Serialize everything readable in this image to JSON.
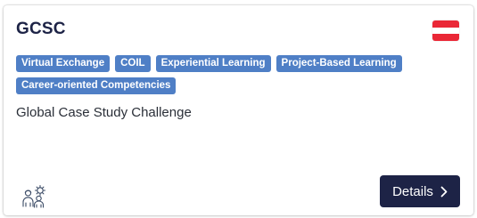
{
  "card": {
    "title": "GCSC",
    "flag_icon": "austria-flag-icon",
    "tags": [
      "Virtual Exchange",
      "COIL",
      "Experiential Learning",
      "Project-Based Learning",
      "Career-oriented Competencies"
    ],
    "description": "Global Case Study Challenge",
    "footer_icon": "people-collaboration-icon",
    "details_label": "Details",
    "details_icon": "chevron-right-icon"
  },
  "colors": {
    "title": "#1d2346",
    "tag_bg": "#4f7fc6",
    "button_bg": "#1d2346",
    "flag_red": "#ea2736"
  }
}
